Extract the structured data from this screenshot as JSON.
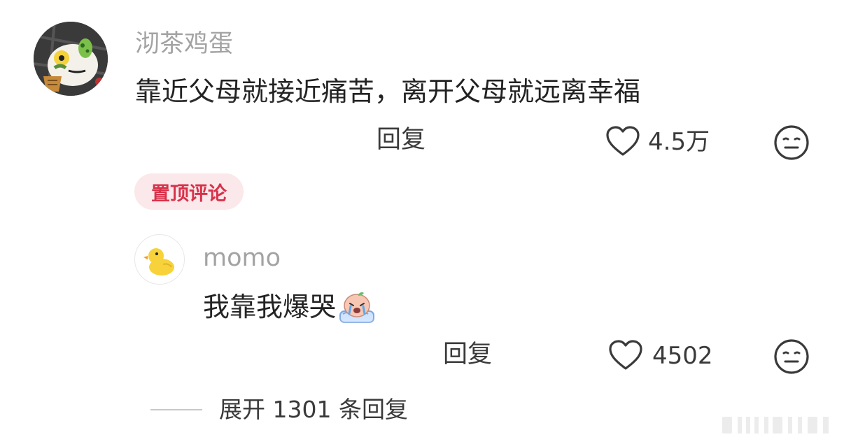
{
  "top_comment": {
    "username": "沏茶鸡蛋",
    "text": "靠近父母就接近痛苦，离开父母就远离幸福",
    "reply_label": "回复",
    "like_count": "4.5万",
    "avatar_icon": "cartoon-cat-avatar",
    "like_icon": "heart-outline-icon",
    "dislike_icon": "meh-face-icon"
  },
  "pinned_badge": "置顶评论",
  "reply_comment": {
    "username": "momo",
    "text": "我靠我爆哭",
    "emoji_icon": "crying-emoji-icon",
    "reply_label": "回复",
    "like_count": "4502",
    "avatar_icon": "duck-avatar",
    "like_icon": "heart-outline-icon",
    "dislike_icon": "meh-face-icon"
  },
  "expand_replies": "展开 1301 条回复",
  "colors": {
    "username": "#a3a3a3",
    "text": "#222222",
    "pinned_bg": "#fbe8ea",
    "pinned_text": "#d8314a"
  }
}
